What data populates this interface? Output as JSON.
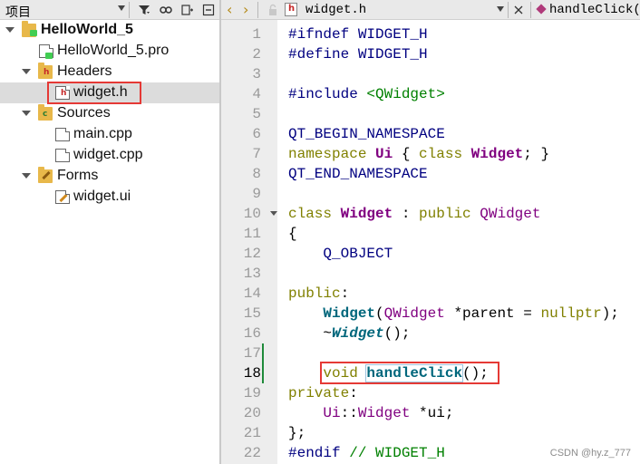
{
  "project_pane": {
    "title": "项目",
    "tree": [
      {
        "label": "HelloWorld_5",
        "bold": true
      },
      {
        "label": "HelloWorld_5.pro"
      },
      {
        "label": "Headers"
      },
      {
        "label": "widget.h"
      },
      {
        "label": "Sources"
      },
      {
        "label": "main.cpp"
      },
      {
        "label": "widget.cpp"
      },
      {
        "label": "Forms"
      },
      {
        "label": "widget.ui"
      }
    ],
    "selected_item": "widget.h"
  },
  "editor": {
    "tab_filename": "widget.h",
    "symbol_combo": "handleClick()",
    "current_line": 18,
    "lines": [
      {
        "num": "1",
        "text": "#ifndef WIDGET_H"
      },
      {
        "num": "2",
        "text": "#define WIDGET_H"
      },
      {
        "num": "3",
        "text": ""
      },
      {
        "num": "4",
        "text": "#include <QWidget>"
      },
      {
        "num": "5",
        "text": ""
      },
      {
        "num": "6",
        "text": "QT_BEGIN_NAMESPACE"
      },
      {
        "num": "7",
        "text": "namespace Ui { class Widget; }"
      },
      {
        "num": "8",
        "text": "QT_END_NAMESPACE"
      },
      {
        "num": "9",
        "text": ""
      },
      {
        "num": "10",
        "text": "class Widget : public QWidget"
      },
      {
        "num": "11",
        "text": "{"
      },
      {
        "num": "12",
        "text": "    Q_OBJECT"
      },
      {
        "num": "13",
        "text": ""
      },
      {
        "num": "14",
        "text": "public:"
      },
      {
        "num": "15",
        "text": "    Widget(QWidget *parent = nullptr);"
      },
      {
        "num": "16",
        "text": "    ~Widget();"
      },
      {
        "num": "17",
        "text": ""
      },
      {
        "num": "18",
        "text": "    void handleClick();"
      },
      {
        "num": "19",
        "text": "private:"
      },
      {
        "num": "20",
        "text": "    Ui::Widget *ui;"
      },
      {
        "num": "21",
        "text": "};"
      },
      {
        "num": "22",
        "text": "#endif // WIDGET_H"
      }
    ]
  },
  "watermark": "CSDN @hy.z_777",
  "colors": {
    "preprocessor": "#000080",
    "keyword": "#808000",
    "type": "#800080",
    "string": "#008000",
    "function": "#00677c",
    "highlight_box": "#e53935",
    "modified_marker": "#1f8a3a"
  }
}
